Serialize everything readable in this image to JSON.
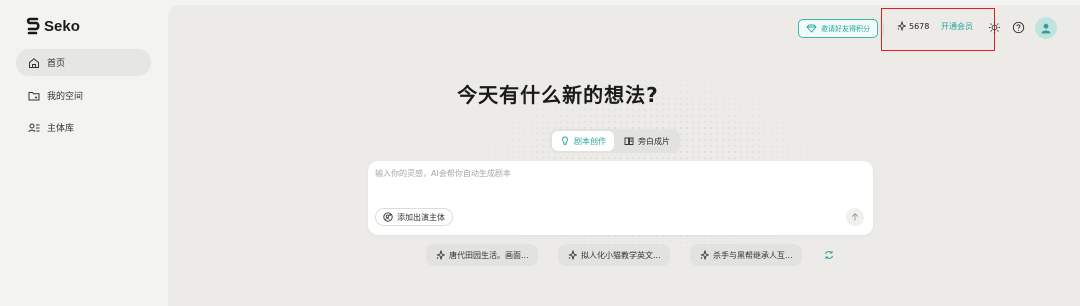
{
  "app": {
    "name": "Seko"
  },
  "sidebar": {
    "items": [
      {
        "label": "首页",
        "icon": "home-icon",
        "active": true
      },
      {
        "label": "我的空间",
        "icon": "folder-icon",
        "active": false
      },
      {
        "label": "主体库",
        "icon": "subject-library-icon",
        "active": false
      }
    ]
  },
  "header": {
    "invite_label": "邀请好友得积分",
    "points": "5678",
    "vip_label": "开通会员",
    "icons": [
      "theme-toggle-icon",
      "help-icon",
      "avatar"
    ]
  },
  "main": {
    "headline": "今天有什么新的想法?",
    "tabs": [
      {
        "label": "剧本创作",
        "icon": "lightbulb-icon",
        "active": true
      },
      {
        "label": "旁白成片",
        "icon": "book-open-icon",
        "active": false
      }
    ],
    "prompt": {
      "value": "",
      "placeholder": "输入你的灵感，AI会帮你自动生成剧本",
      "add_actor_label": "添加出演主体"
    },
    "suggestions": [
      "唐代田园生活。画面...",
      "拟人化小猫教学英文...",
      "杀手与黑帮继承人互..."
    ]
  },
  "colors": {
    "accent": "#2aa59d",
    "highlight": "#e02020",
    "panel": "#ecebe8"
  }
}
